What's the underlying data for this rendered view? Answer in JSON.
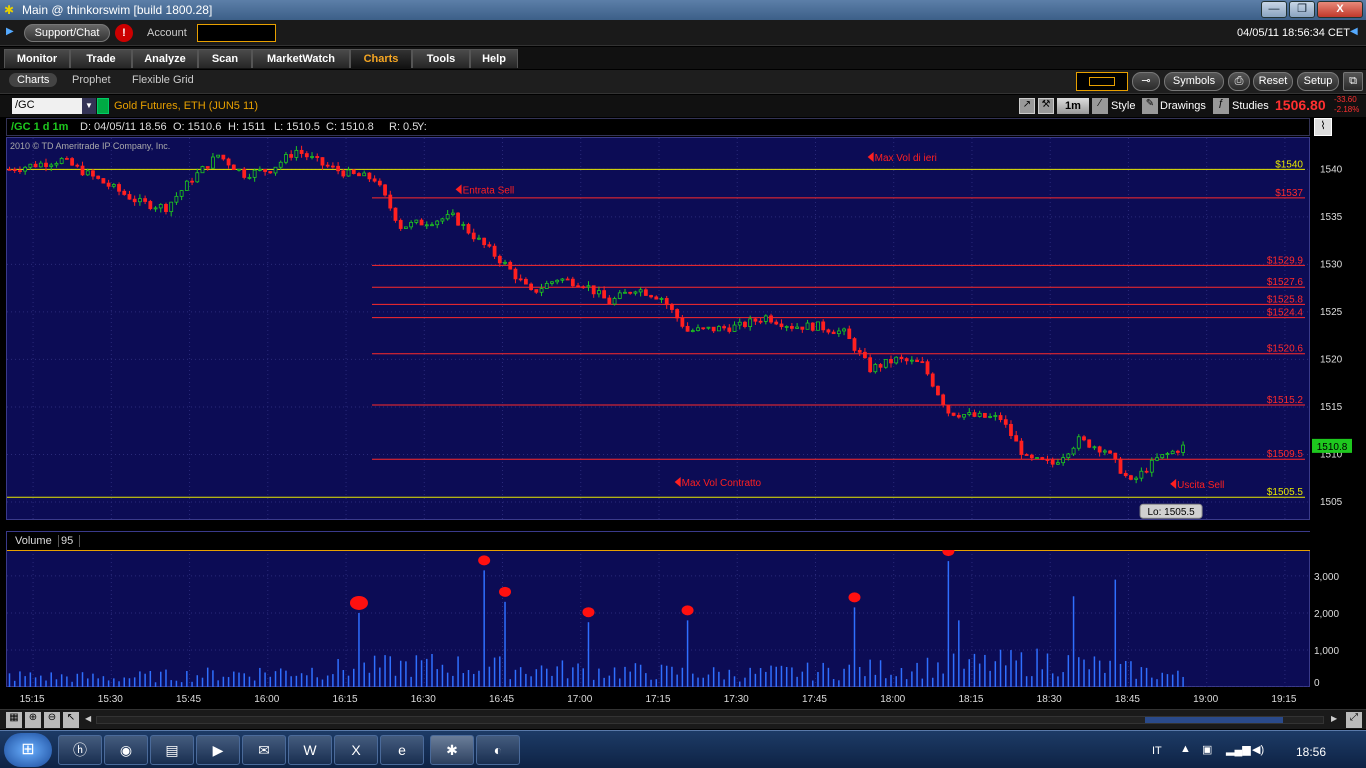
{
  "window": {
    "title": "Main @ thinkorswim [build 1800.28]",
    "minimize": "—",
    "restore": "❐",
    "close": "X"
  },
  "toolbar": {
    "support_label": "Support/Chat",
    "alert_label": "!",
    "account_label": "Account",
    "datetime": "04/05/11 18:56:34 CET"
  },
  "nav": {
    "tabs": [
      "Monitor",
      "Trade",
      "Analyze",
      "Scan",
      "MarketWatch",
      "Charts",
      "Tools",
      "Help"
    ]
  },
  "subnav": {
    "tabs": [
      "Charts",
      "Prophet",
      "Flexible Grid"
    ],
    "symbols_label": "Symbols",
    "reset_label": "Reset",
    "setup_label": "Setup"
  },
  "symbolbar": {
    "symbol": "/GC",
    "description": "Gold Futures, ETH (JUN5 11)",
    "interval": "1m",
    "style_label": "Style",
    "drawings_label": "Drawings",
    "studies_label": "Studies",
    "last_price": "1506.80",
    "change": "-33.60",
    "change_pct": "-2.18%"
  },
  "infobar": {
    "symbol": "/GC 1 d 1m",
    "date": "D: 04/05/11 18.56",
    "open": "O: 1510.6",
    "high": "H: 1511",
    "low": "L: 1510.5",
    "close": "C: 1510.8",
    "range": "R: 0.5",
    "y": "Y:"
  },
  "copyright": "2010 © TD Ameritrade IP Company, Inc.",
  "colors": {
    "up": "#1ec81e",
    "down": "#ff2020",
    "chart_bg": "#0c0c55",
    "level_line": "#ff2a2a",
    "key_level": "#e8e800",
    "annotation": "#ff2020",
    "volume_bar": "#2f6fff"
  },
  "chart_data": {
    "type": "candlestick",
    "time_range": [
      "15:10",
      "19:20"
    ],
    "x_ticks": [
      "15:15",
      "15:30",
      "15:45",
      "16:00",
      "16:15",
      "16:30",
      "16:45",
      "17:00",
      "17:15",
      "17:30",
      "17:45",
      "18:00",
      "18:15",
      "18:30",
      "18:45",
      "19:00",
      "19:15"
    ],
    "y_ticks": [
      1505,
      1510,
      1515,
      1520,
      1525,
      1530,
      1535,
      1540
    ],
    "ylim": [
      1503,
      1543.3
    ],
    "levels": [
      {
        "label": "$1540",
        "value": 1540,
        "color": "#e8e800",
        "style": "key"
      },
      {
        "label": "$1537",
        "value": 1537,
        "color": "#ff2a2a"
      },
      {
        "label": "$1529.9",
        "value": 1529.9,
        "color": "#ff2a2a"
      },
      {
        "label": "$1527.6",
        "value": 1527.6,
        "color": "#ff2a2a"
      },
      {
        "label": "$1525.8",
        "value": 1525.8,
        "color": "#ff2a2a"
      },
      {
        "label": "$1524.4",
        "value": 1524.4,
        "color": "#ff2a2a"
      },
      {
        "label": "$1520.6",
        "value": 1520.6,
        "color": "#ff2a2a"
      },
      {
        "label": "$1515.2",
        "value": 1515.2,
        "color": "#ff2a2a"
      },
      {
        "label": "$1509.5",
        "value": 1509.5,
        "color": "#ff2a2a"
      },
      {
        "label": "$1505.5",
        "value": 1505.5,
        "color": "#e8e800",
        "style": "key"
      }
    ],
    "annotations": [
      {
        "text": "Max Vol di ieri",
        "time": "17:55",
        "value": 1541.3
      },
      {
        "text": "Entrata Sell",
        "time": "16:36",
        "value": 1537.9
      },
      {
        "text": "Max Vol Contratto",
        "time": "17:18",
        "value": 1507.1
      },
      {
        "text": "Uscita Sell",
        "time": "18:53",
        "value": 1506.9
      }
    ],
    "current_price": {
      "label": "1510.8",
      "value": 1510.8
    },
    "low_label": {
      "text": "Lo: 1505.5",
      "time": "18:48",
      "value": 1505.5
    },
    "price_path": [
      [
        "15:10",
        1540
      ],
      [
        "15:15",
        1540.5
      ],
      [
        "15:20",
        1541
      ],
      [
        "15:25",
        1539.5
      ],
      [
        "15:30",
        1538
      ],
      [
        "15:35",
        1536.5
      ],
      [
        "15:40",
        1536
      ],
      [
        "15:45",
        1539
      ],
      [
        "15:50",
        1541.5
      ],
      [
        "15:55",
        1539.5
      ],
      [
        "16:00",
        1540
      ],
      [
        "16:05",
        1542
      ],
      [
        "16:10",
        1540.5
      ],
      [
        "16:15",
        1539.5
      ],
      [
        "16:20",
        1539
      ],
      [
        "16:25",
        1534
      ],
      [
        "16:30",
        1534.5
      ],
      [
        "16:35",
        1535
      ],
      [
        "16:40",
        1532.5
      ],
      [
        "16:45",
        1530
      ],
      [
        "16:50",
        1527
      ],
      [
        "16:55",
        1528.5
      ],
      [
        "17:00",
        1528
      ],
      [
        "17:05",
        1526
      ],
      [
        "17:10",
        1527.5
      ],
      [
        "17:15",
        1526.5
      ],
      [
        "17:20",
        1523
      ],
      [
        "17:25",
        1523.2
      ],
      [
        "17:30",
        1523.5
      ],
      [
        "17:35",
        1524.5
      ],
      [
        "17:40",
        1523.5
      ],
      [
        "17:45",
        1523.5
      ],
      [
        "17:50",
        1522.8
      ],
      [
        "17:55",
        1519
      ],
      [
        "18:00",
        1520
      ],
      [
        "18:05",
        1519.5
      ],
      [
        "18:10",
        1514.5
      ],
      [
        "18:15",
        1514
      ],
      [
        "18:20",
        1513.8
      ],
      [
        "18:25",
        1509.5
      ],
      [
        "18:30",
        1509
      ],
      [
        "18:35",
        1511.5
      ],
      [
        "18:40",
        1510.5
      ],
      [
        "18:45",
        1507
      ],
      [
        "18:50",
        1509.5
      ],
      [
        "18:55",
        1510.8
      ]
    ],
    "volume": {
      "title": "Volume",
      "last": "95",
      "y_ticks": [
        0,
        1000,
        2000,
        3000
      ],
      "ylim": [
        0,
        3700
      ],
      "path": [
        [
          "15:10",
          300
        ],
        [
          "15:30",
          250
        ],
        [
          "16:00",
          400
        ],
        [
          "16:15",
          500
        ],
        [
          "16:30",
          600
        ],
        [
          "17:00",
          450
        ],
        [
          "17:30",
          350
        ],
        [
          "18:00",
          500
        ],
        [
          "18:30",
          700
        ],
        [
          "19:00",
          200
        ]
      ],
      "spikes": [
        {
          "time": "16:17",
          "value": 2000
        },
        {
          "time": "16:41",
          "value": 3150
        },
        {
          "time": "16:45",
          "value": 2300
        },
        {
          "time": "17:01",
          "value": 1750
        },
        {
          "time": "17:20",
          "value": 1800
        },
        {
          "time": "17:52",
          "value": 2150
        },
        {
          "time": "18:10",
          "value": 3400
        },
        {
          "time": "18:12",
          "value": 1800
        },
        {
          "time": "18:34",
          "value": 2450
        },
        {
          "time": "18:42",
          "value": 2900
        }
      ],
      "circles": [
        "16:17",
        "16:41",
        "16:45",
        "17:01",
        "17:20",
        "17:52",
        "18:10"
      ]
    }
  },
  "taskbar": {
    "lang": "IT",
    "clock": "18:56"
  }
}
